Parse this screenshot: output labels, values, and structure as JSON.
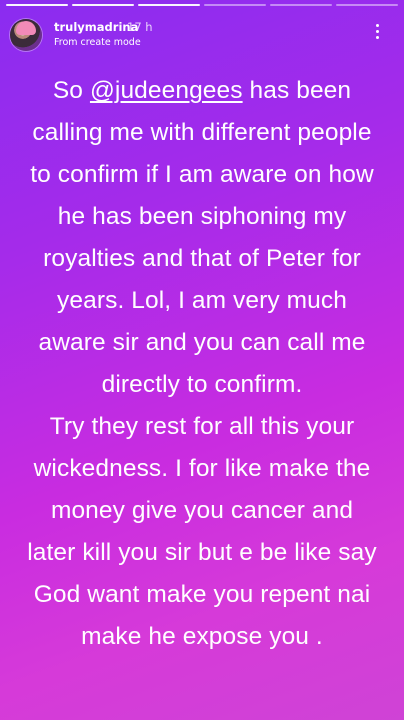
{
  "progress": {
    "total": 6,
    "seen": 3
  },
  "header": {
    "username": "trulymadrina",
    "time": "17 h",
    "subtitle": "From create mode",
    "more_icon": "more-vertical-icon"
  },
  "story": {
    "lines": [
      {
        "before": "So ",
        "mention": "@judeengees",
        "after": " has been"
      },
      {
        "text": "calling me with different people"
      },
      {
        "text": "to confirm if I am aware on how"
      },
      {
        "text": "he has been siphoning my"
      },
      {
        "text": "royalties and that of Peter for"
      },
      {
        "text": "years. Lol, I am very much"
      },
      {
        "text": "aware sir and you can call me"
      },
      {
        "text": "directly to confirm."
      },
      {
        "text": "Try they rest for all this your"
      },
      {
        "text": "wickedness. I for like make the"
      },
      {
        "text": "money give you cancer and"
      },
      {
        "text": "later kill you sir  but e be like say"
      },
      {
        "text": "God want make you repent nai"
      },
      {
        "text": "make he expose you ."
      }
    ]
  },
  "colors": {
    "gradient_start": "#8a2cf0",
    "gradient_end": "#cf43d6",
    "text": "#ffffff"
  }
}
